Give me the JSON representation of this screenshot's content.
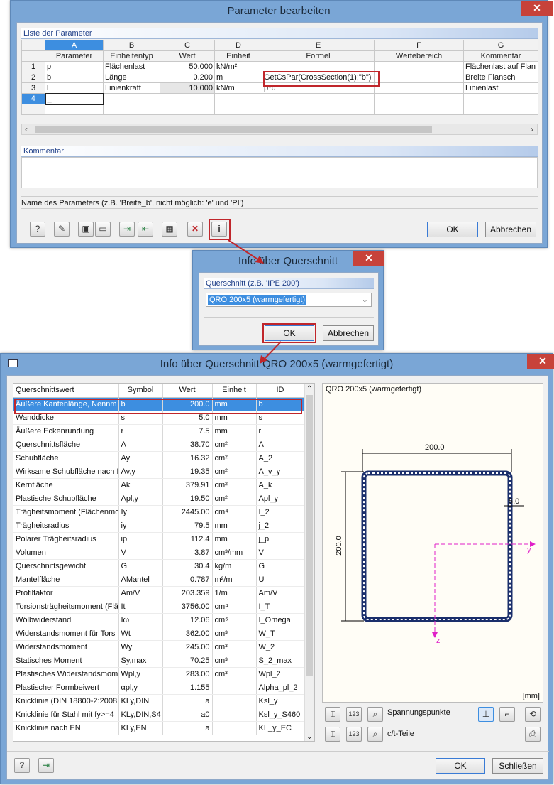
{
  "param_dialog": {
    "title": "Parameter bearbeiten",
    "close_glyph": "✕",
    "list_header": "Liste der Parameter",
    "col_letters": [
      "A",
      "B",
      "C",
      "D",
      "E",
      "F",
      "G"
    ],
    "col_titles": [
      "Parameter",
      "Einheitentyp",
      "Wert",
      "Einheit",
      "Formel",
      "Wertebereich",
      "Kommentar"
    ],
    "rows": [
      {
        "n": "1",
        "a": "p",
        "b": "Flächenlast",
        "c": "50.000",
        "d": "kN/m²",
        "e": "",
        "f": "",
        "g": "Flächenlast auf Flan"
      },
      {
        "n": "2",
        "a": "b",
        "b": "Länge",
        "c": "0.200",
        "d": "m",
        "e": "GetCsPar(CrossSection(1);\"b\")",
        "f": "",
        "g": "Breite Flansch"
      },
      {
        "n": "3",
        "a": "l",
        "b": "Linienkraft",
        "c": "10.000",
        "d": "kN/m",
        "e": "p*b",
        "f": "",
        "g": "Linienlast"
      },
      {
        "n": "4",
        "a": "_",
        "b": "",
        "c": "",
        "d": "",
        "e": "",
        "f": "",
        "g": ""
      }
    ],
    "kommentar_header": "Kommentar",
    "status": "Name des Parameters (z.B. 'Breite_b', nicht möglich: 'e' und 'PI')",
    "ok": "OK",
    "cancel": "Abbrechen"
  },
  "cs_dialog": {
    "title": "Info über Querschnitt",
    "close_glyph": "✕",
    "group_label": "Querschnitt (z.B. 'IPE 200')",
    "selected": "QRO 200x5 (warmgefertigt)",
    "ok": "OK",
    "cancel": "Abbrechen"
  },
  "info_dialog": {
    "title": "Info über Querschnitt QRO 200x5 (warmgefertigt)",
    "close_glyph": "✕",
    "headers": [
      "Querschnittswert",
      "Symbol",
      "Wert",
      "Einheit",
      "ID"
    ],
    "rows": [
      {
        "name": "Äußere Kantenlänge, Nennm",
        "sym": "b",
        "val": "200.0",
        "unit": "mm",
        "id": "b"
      },
      {
        "name": "Wanddicke",
        "sym": "s",
        "val": "5.0",
        "unit": "mm",
        "id": "s"
      },
      {
        "name": "Äußere Eckenrundung",
        "sym": "r",
        "val": "7.5",
        "unit": "mm",
        "id": "r"
      },
      {
        "name": "Querschnittsfläche",
        "sym": "A",
        "val": "38.70",
        "unit": "cm²",
        "id": "A"
      },
      {
        "name": "Schubfläche",
        "sym": "Ay",
        "val": "16.32",
        "unit": "cm²",
        "id": "A_2"
      },
      {
        "name": "Wirksame Schubfläche nach E",
        "sym": "Av,y",
        "val": "19.35",
        "unit": "cm²",
        "id": "A_v_y"
      },
      {
        "name": "Kernfläche",
        "sym": "Ak",
        "val": "379.91",
        "unit": "cm²",
        "id": "A_k"
      },
      {
        "name": "Plastische Schubfläche",
        "sym": "Apl,y",
        "val": "19.50",
        "unit": "cm²",
        "id": "Apl_y"
      },
      {
        "name": "Trägheitsmoment (Flächenmo",
        "sym": "Iy",
        "val": "2445.00",
        "unit": "cm⁴",
        "id": "I_2"
      },
      {
        "name": "Trägheitsradius",
        "sym": "iy",
        "val": "79.5",
        "unit": "mm",
        "id": "j_2"
      },
      {
        "name": "Polarer Trägheitsradius",
        "sym": "ip",
        "val": "112.4",
        "unit": "mm",
        "id": "j_p"
      },
      {
        "name": "Volumen",
        "sym": "V",
        "val": "3.87",
        "unit": "cm³/mm",
        "id": "V"
      },
      {
        "name": "Querschnittsgewicht",
        "sym": "G",
        "val": "30.4",
        "unit": "kg/m",
        "id": "G"
      },
      {
        "name": "Mantelfläche",
        "sym": "AMantel",
        "val": "0.787",
        "unit": "m²/m",
        "id": "U"
      },
      {
        "name": "Profilfaktor",
        "sym": "Am/V",
        "val": "203.359",
        "unit": "1/m",
        "id": "Am/V"
      },
      {
        "name": "Torsionsträgheitsmoment (Flä",
        "sym": "It",
        "val": "3756.00",
        "unit": "cm⁴",
        "id": "I_T"
      },
      {
        "name": "Wölbwiderstand",
        "sym": "Iω",
        "val": "12.06",
        "unit": "cm⁶",
        "id": "I_Omega"
      },
      {
        "name": "Widerstandsmoment für Tors",
        "sym": "Wt",
        "val": "362.00",
        "unit": "cm³",
        "id": "W_T"
      },
      {
        "name": "Widerstandsmoment",
        "sym": "Wy",
        "val": "245.00",
        "unit": "cm³",
        "id": "W_2"
      },
      {
        "name": "Statisches Moment",
        "sym": "Sy,max",
        "val": "70.25",
        "unit": "cm³",
        "id": "S_2_max"
      },
      {
        "name": "Plastisches Widerstandsmome",
        "sym": "Wpl,y",
        "val": "283.00",
        "unit": "cm³",
        "id": "Wpl_2"
      },
      {
        "name": "Plastischer Formbeiwert",
        "sym": "αpl,y",
        "val": "1.155",
        "unit": "",
        "id": "Alpha_pl_2"
      },
      {
        "name": "Knicklinie (DIN 18800-2:2008",
        "sym": "KLy,DIN",
        "val": "a",
        "unit": "",
        "id": "Ksl_y"
      },
      {
        "name": "Knicklinie für Stahl mit fy>=4",
        "sym": "KLy,DIN,S4",
        "val": "a0",
        "unit": "",
        "id": "Ksl_y_S460"
      },
      {
        "name": "Knicklinie nach EN",
        "sym": "KLy,EN",
        "val": "a",
        "unit": "",
        "id": "KL_y_EC"
      }
    ],
    "preview_title": "QRO 200x5 (warmgefertigt)",
    "dim_width": "200.0",
    "dim_height": "200.0",
    "dim_thickness": "5.0",
    "axis_y": "y",
    "axis_z": "z",
    "unit_label": "[mm]",
    "spannungspunkte": "Spannungspunkte",
    "ct_teile": "c/t-Teile",
    "ok": "OK",
    "close": "Schließen"
  }
}
